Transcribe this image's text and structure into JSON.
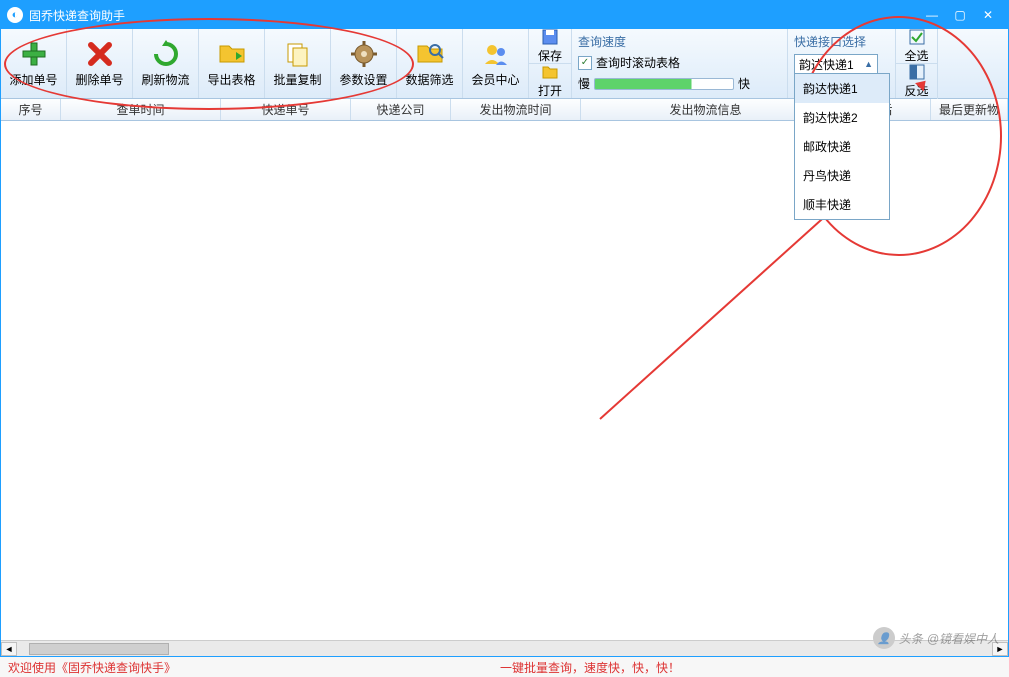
{
  "window": {
    "title": "固乔快递查询助手",
    "minimize": "—",
    "maximize": "▢",
    "close": "✕"
  },
  "toolbar": {
    "add": "添加单号",
    "del": "删除单号",
    "refresh": "刷新物流",
    "export": "导出表格",
    "batchcopy": "批量复制",
    "params": "参数设置",
    "filter": "数据筛选",
    "member": "会员中心",
    "save": "保存",
    "open": "打开"
  },
  "speed": {
    "title": "查询速度",
    "scroll_chk": "查询时滚动表格",
    "slow": "慢",
    "fast": "快"
  },
  "iface": {
    "title": "快递接口选择",
    "selected": "韵达快递1",
    "options": [
      "韵达快递1",
      "韵达快递2",
      "邮政快递",
      "丹鸟快递",
      "顺丰快递"
    ]
  },
  "rightbtns": {
    "selall": "全选",
    "invert": "反选"
  },
  "columns": {
    "idx": "序号",
    "qtime": "查单时间",
    "trackno": "快递单号",
    "company": "快递公司",
    "shiptime": "发出物流时间",
    "shipinfo": "发出物流信息",
    "lasttime": "最后",
    "lastinfo": "最后更新物"
  },
  "status": {
    "welcome": "欢迎使用《固乔快递查询快手》",
    "tagline": "一键批量查询，速度快，快，快！"
  },
  "watermark": {
    "prefix": "头条",
    "author": "@镜看娱中人"
  }
}
